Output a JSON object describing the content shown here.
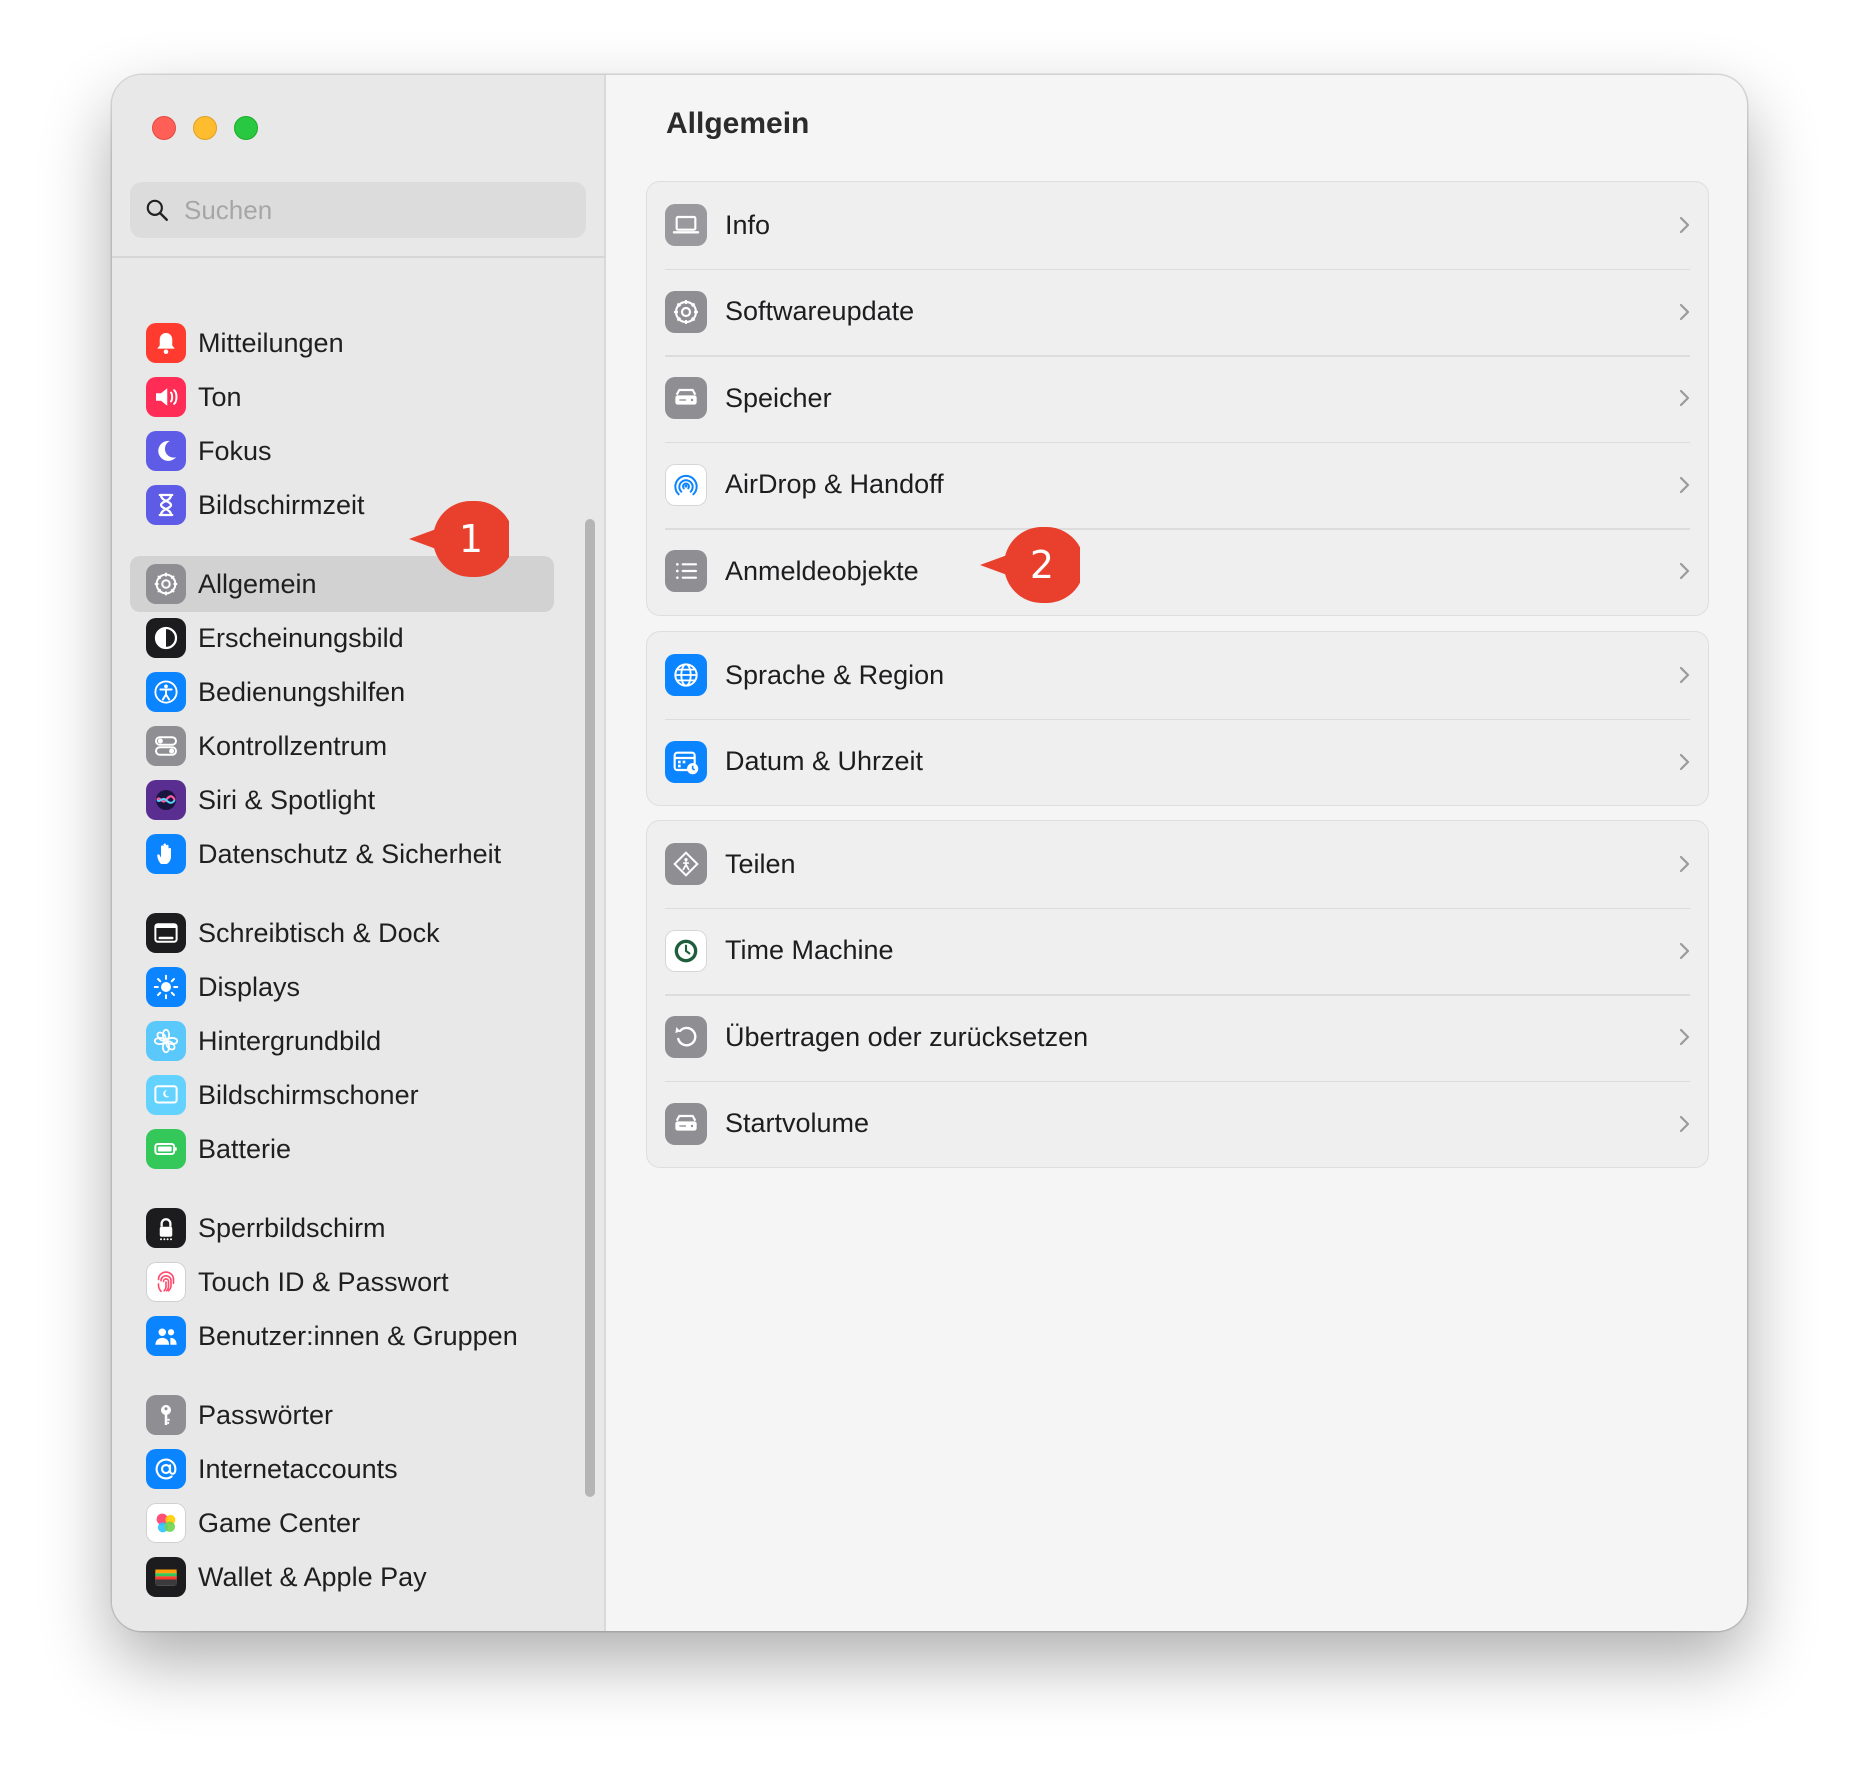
{
  "window": {
    "search": {
      "placeholder": "Suchen",
      "icon": "magnifier-icon"
    },
    "sidebar": {
      "items": [
        {
          "label": "Mitteilungen",
          "icon": "bell-icon",
          "color": "#ff3b30"
        },
        {
          "label": "Ton",
          "icon": "speaker-icon",
          "color": "#ff2d55"
        },
        {
          "label": "Fokus",
          "icon": "moon-icon",
          "color": "#5e5ce6"
        },
        {
          "label": "Bildschirmzeit",
          "icon": "hourglass-icon",
          "color": "#5e5ce6"
        },
        {
          "label": "Allgemein",
          "icon": "gear-icon",
          "color": "#8e8e93",
          "selected": true
        },
        {
          "label": "Erscheinungsbild",
          "icon": "appearance-icon",
          "color": "#1c1c1e"
        },
        {
          "label": "Bedienungshilfen",
          "icon": "accessibility-icon",
          "color": "#0a84ff"
        },
        {
          "label": "Kontrollzentrum",
          "icon": "toggles-icon",
          "color": "#8e8e93"
        },
        {
          "label": "Siri & Spotlight",
          "icon": "siri-icon",
          "color": "#5a2d91"
        },
        {
          "label": "Datenschutz & Sicherheit",
          "icon": "hand-icon",
          "color": "#0a84ff"
        },
        {
          "label": "Schreibtisch & Dock",
          "icon": "dock-icon",
          "color": "#1c1c1e"
        },
        {
          "label": "Displays",
          "icon": "sun-icon",
          "color": "#0a84ff"
        },
        {
          "label": "Hintergrundbild",
          "icon": "flower-icon",
          "color": "#5ac8fa"
        },
        {
          "label": "Bildschirmschoner",
          "icon": "screensaver-icon",
          "color": "#64d2ff"
        },
        {
          "label": "Batterie",
          "icon": "battery-icon",
          "color": "#34c759"
        },
        {
          "label": "Sperrbildschirm",
          "icon": "lock-icon",
          "color": "#1c1c1e"
        },
        {
          "label": "Touch ID & Passwort",
          "icon": "fingerprint-icon",
          "color": "#ffffff"
        },
        {
          "label": "Benutzer:innen & Gruppen",
          "icon": "users-icon",
          "color": "#0a84ff"
        },
        {
          "label": "Passwörter",
          "icon": "key-icon",
          "color": "#8e8e93"
        },
        {
          "label": "Internetaccounts",
          "icon": "at-icon",
          "color": "#0a84ff"
        },
        {
          "label": "Game Center",
          "icon": "gamecenter-icon",
          "color": "#ffffff"
        },
        {
          "label": "Wallet & Apple Pay",
          "icon": "wallet-icon",
          "color": "#1c1c1e"
        }
      ]
    },
    "content": {
      "title": "Allgemein",
      "groups": [
        {
          "rows": [
            {
              "label": "Info",
              "icon": "laptop-icon"
            },
            {
              "label": "Softwareupdate",
              "icon": "gear-icon"
            },
            {
              "label": "Speicher",
              "icon": "drive-icon"
            },
            {
              "label": "AirDrop & Handoff",
              "icon": "airdrop-icon"
            },
            {
              "label": "Anmeldeobjekte",
              "icon": "list-icon"
            }
          ]
        },
        {
          "rows": [
            {
              "label": "Sprache & Region",
              "icon": "globe-icon"
            },
            {
              "label": "Datum & Uhrzeit",
              "icon": "calendar-clock-icon"
            }
          ]
        },
        {
          "rows": [
            {
              "label": "Teilen",
              "icon": "sharing-icon"
            },
            {
              "label": "Time Machine",
              "icon": "timemachine-icon"
            },
            {
              "label": "Übertragen oder zurücksetzen",
              "icon": "reset-icon"
            },
            {
              "label": "Startvolume",
              "icon": "drive-icon"
            }
          ]
        }
      ]
    },
    "callouts": [
      {
        "number": "1"
      },
      {
        "number": "2"
      }
    ]
  },
  "colors": {
    "callout": "#e8402c",
    "accent": "#0a84ff"
  }
}
